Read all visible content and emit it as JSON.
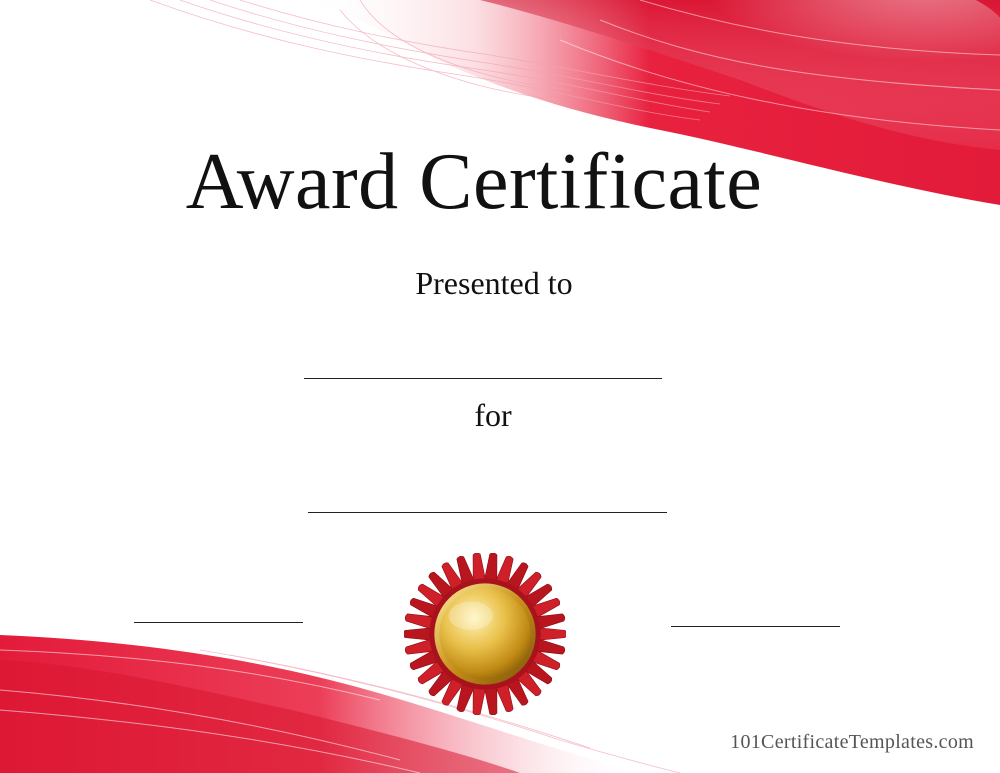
{
  "certificate": {
    "title": "Award Certificate",
    "presented_to_label": "Presented to",
    "for_label": "for",
    "website": "101CertificateTemplates.com"
  },
  "icons": {
    "seal": "gold-award-seal-icon"
  },
  "colors": {
    "accent_red": "#e8213f",
    "deep_red": "#c8102e",
    "seal_ribbon": "#c41e24",
    "seal_gold": "#d4a21a"
  }
}
